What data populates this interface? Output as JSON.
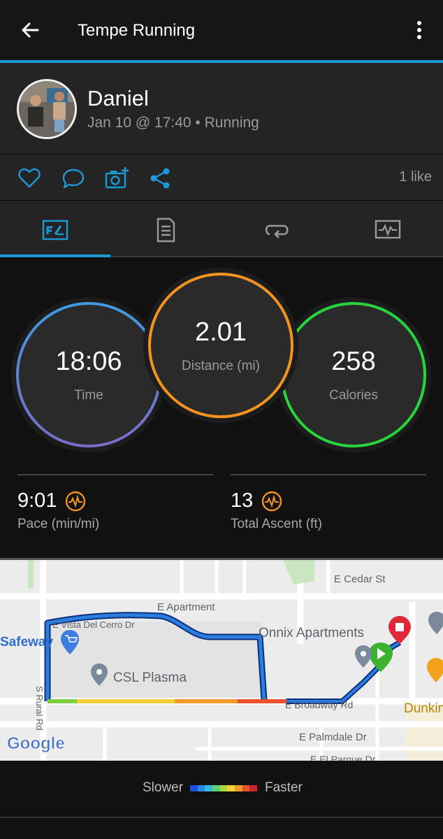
{
  "header": {
    "title": "Tempe Running",
    "accent": "#1a9ad6"
  },
  "profile": {
    "name": "Daniel",
    "meta": "Jan 10 @ 17:40 • Running"
  },
  "actions": {
    "icons": [
      "heart-icon",
      "comment-icon",
      "camera-add-icon",
      "share-icon"
    ],
    "likes": "1 like"
  },
  "tabs": [
    "stats-tab",
    "details-tab",
    "laps-tab",
    "charts-tab"
  ],
  "stats": {
    "time": {
      "value": "18:06",
      "label": "Time"
    },
    "distance": {
      "value": "2.01",
      "label": "Distance (mi)"
    },
    "calories": {
      "value": "258",
      "label": "Calories"
    },
    "pace": {
      "value": "9:01",
      "label": "Pace (min/mi)"
    },
    "ascent": {
      "value": "13",
      "label": "Total Ascent (ft)"
    },
    "colors": {
      "time": "#3f8fd8",
      "distance": "#f3931e",
      "calories": "#27d43c"
    }
  },
  "map": {
    "labels": {
      "cedar": "E Cedar St",
      "apartment": "E Apartment",
      "vista": "E Vista Del Cerro Dr",
      "safeway": "Safeway",
      "onnix": "Onnix Apartments",
      "csl": "CSL Plasma",
      "rural": "S Rural Rd",
      "broadway": "E Broadway Rd",
      "dunkin": "Dunkin",
      "palmdale": "E Palmdale Dr",
      "elparque": "E El Parque Dr",
      "google": "Google"
    }
  },
  "legend": {
    "slower": "Slower",
    "faster": "Faster",
    "colors": [
      "#1f4fd6",
      "#2a86e8",
      "#33b8e0",
      "#5fd36a",
      "#a8d83a",
      "#f1d03a",
      "#f39a2e",
      "#e8512d",
      "#c9282d"
    ]
  }
}
